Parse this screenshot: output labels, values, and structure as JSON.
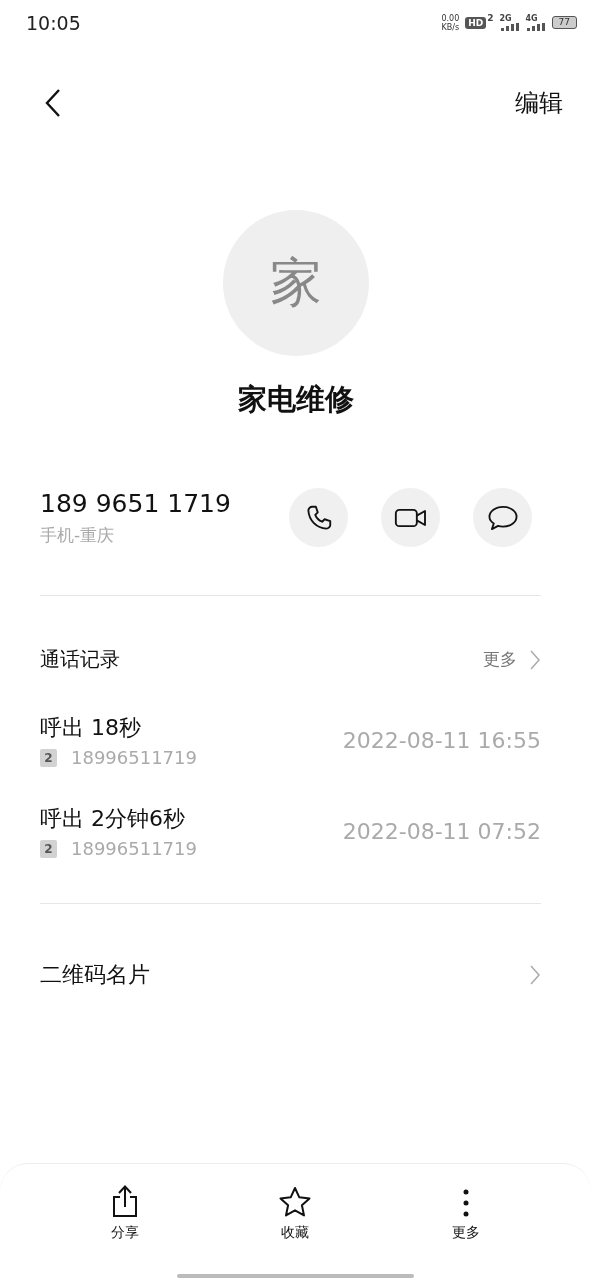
{
  "status_bar": {
    "time": "10:05",
    "net_speed": "0.00",
    "net_unit": "KB/s",
    "hd_label": "HD",
    "hd_sim": "2",
    "sim1": "2G",
    "sim2": "4G",
    "battery": "77"
  },
  "header": {
    "edit": "编辑"
  },
  "contact": {
    "avatar_letter": "家",
    "name": "家电维修",
    "phone": "189 9651 1719",
    "phone_label": "手机-重庆",
    "actions": [
      {
        "kind": "call"
      },
      {
        "kind": "video"
      },
      {
        "kind": "message"
      }
    ]
  },
  "call_log": {
    "title": "通话记录",
    "more": "更多",
    "entries": [
      {
        "summary": "呼出 18秒",
        "sim": "2",
        "number": "18996511719",
        "time": "2022-08-11 16:55"
      },
      {
        "summary": "呼出 2分钟6秒",
        "sim": "2",
        "number": "18996511719",
        "time": "2022-08-11 07:52"
      }
    ]
  },
  "qr_card": {
    "label": "二维码名片"
  },
  "bottom_bar": [
    {
      "kind": "share",
      "label": "分享"
    },
    {
      "kind": "favorite",
      "label": "收藏"
    },
    {
      "kind": "more",
      "label": "更多"
    }
  ]
}
